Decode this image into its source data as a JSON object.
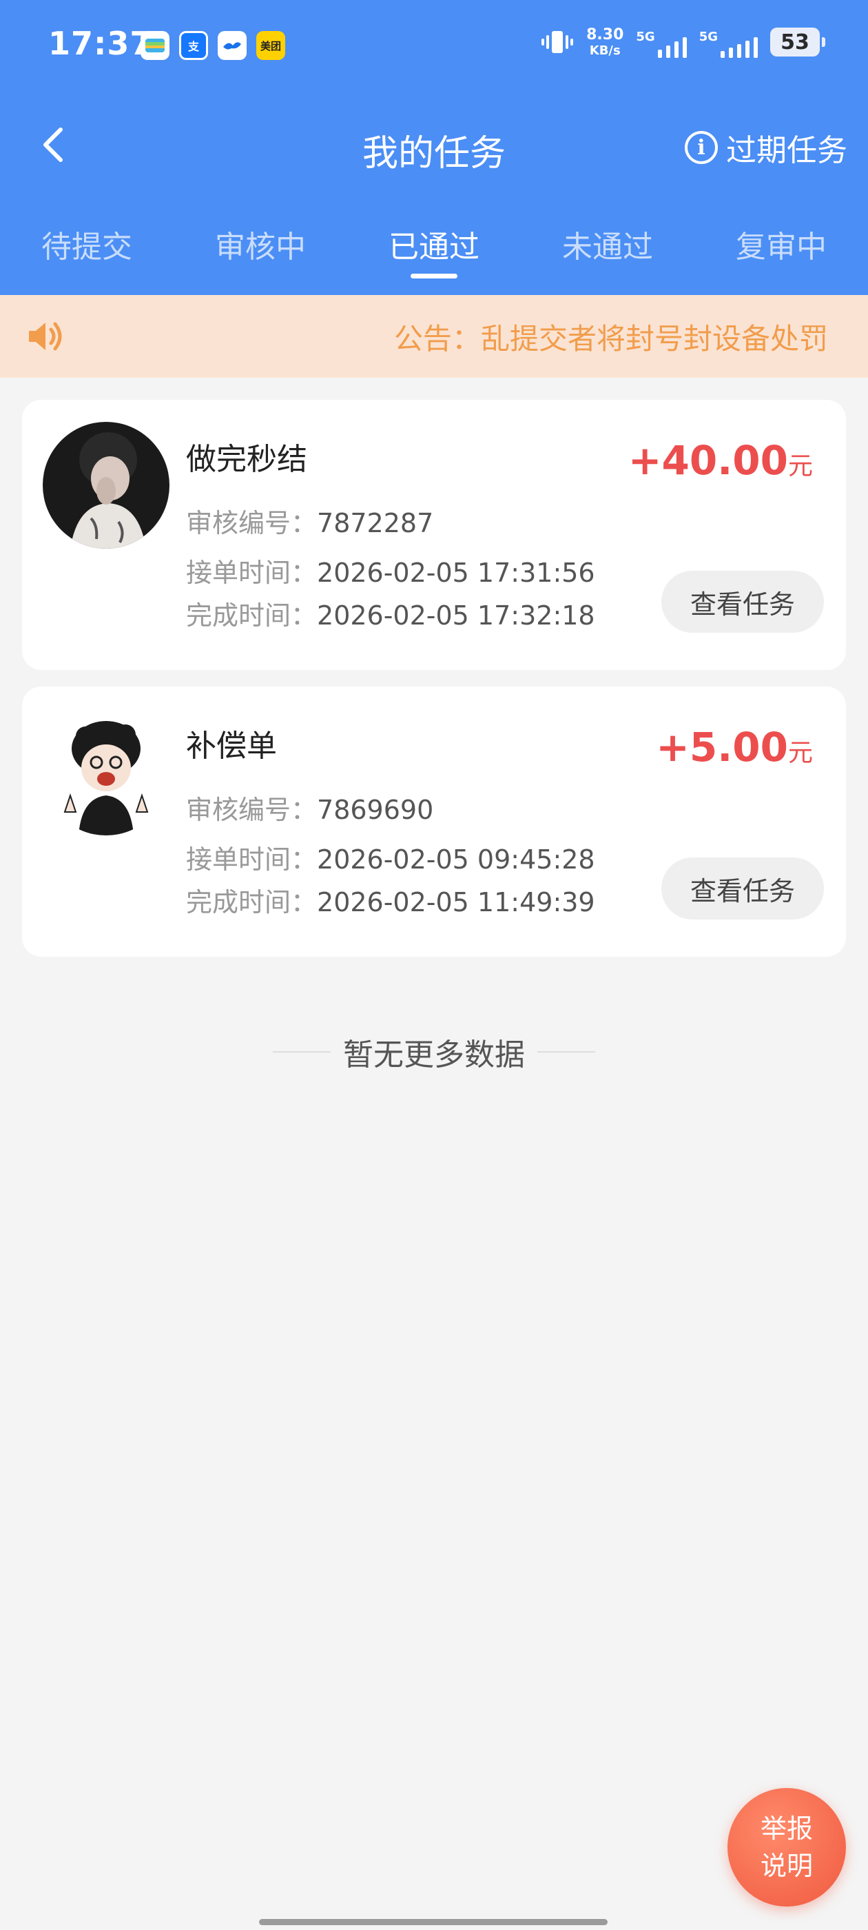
{
  "status_bar": {
    "time": "17:37",
    "app_icons": [
      "wallet-icon",
      "alipay-icon",
      "bird-app-icon",
      "meituan-icon"
    ],
    "meituan_label": "美团",
    "alipay_label": "支",
    "net_speed_value": "8.30",
    "net_speed_unit": "KB/s",
    "sim1_label": "5G",
    "sim2_label": "5G",
    "battery": "53"
  },
  "navbar": {
    "title": "我的任务",
    "expired_label": "过期任务"
  },
  "tabs": [
    {
      "label": "待提交",
      "active": false
    },
    {
      "label": "审核中",
      "active": false
    },
    {
      "label": "已通过",
      "active": true
    },
    {
      "label": "未通过",
      "active": false
    },
    {
      "label": "复审中",
      "active": false
    }
  ],
  "notice": {
    "text": "公告：乱提交者将封号封设备处罚"
  },
  "tasks": [
    {
      "name": "做完秒结",
      "amount": "+40.00",
      "unit": "元",
      "review_id_label": "审核编号：",
      "review_id": "7872287",
      "accept_label": "接单时间：",
      "accept_time": "2026-02-05 17:31:56",
      "finish_label": "完成时间：",
      "finish_time": "2026-02-05 17:32:18",
      "button": "查看任务"
    },
    {
      "name": "补偿单",
      "amount": "+5.00",
      "unit": "元",
      "review_id_label": "审核编号：",
      "review_id": "7869690",
      "accept_label": "接单时间：",
      "accept_time": "2026-02-05 09:45:28",
      "finish_label": "完成时间：",
      "finish_time": "2026-02-05 11:49:39",
      "button": "查看任务"
    }
  ],
  "no_more": "暂无更多数据",
  "report_button": {
    "line1": "举报",
    "line2": "说明"
  },
  "colors": {
    "header": "#4b8ef5",
    "notice_bg": "#fbe3d3",
    "notice_text": "#f19d4c",
    "amount": "#ec4e4e",
    "report": "#f05a40"
  }
}
